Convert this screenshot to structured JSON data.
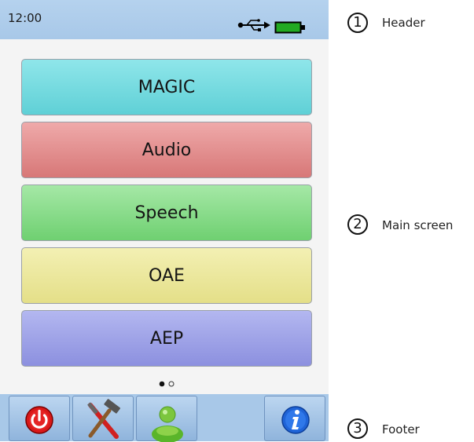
{
  "header": {
    "time": "12:00",
    "usb_icon": "usb-icon",
    "battery_icon": "battery-full-icon",
    "battery_color": "#22aa22"
  },
  "menu": {
    "items": [
      {
        "label": "MAGIC",
        "color": "#5fd0d6"
      },
      {
        "label": "Audio",
        "color": "#d77777"
      },
      {
        "label": "Speech",
        "color": "#6fd071"
      },
      {
        "label": "OAE",
        "color": "#e4df88"
      },
      {
        "label": "AEP",
        "color": "#8c90df"
      }
    ],
    "page_indicator": {
      "pages": 2,
      "current": 1
    }
  },
  "footer": {
    "buttons": [
      {
        "icon": "power-icon"
      },
      {
        "icon": "tools-icon"
      },
      {
        "icon": "user-icon"
      },
      {
        "icon": "info-icon"
      }
    ]
  },
  "annotations": [
    {
      "number": "1",
      "label": "Header"
    },
    {
      "number": "2",
      "label": "Main screen"
    },
    {
      "number": "3",
      "label": "Footer"
    }
  ]
}
